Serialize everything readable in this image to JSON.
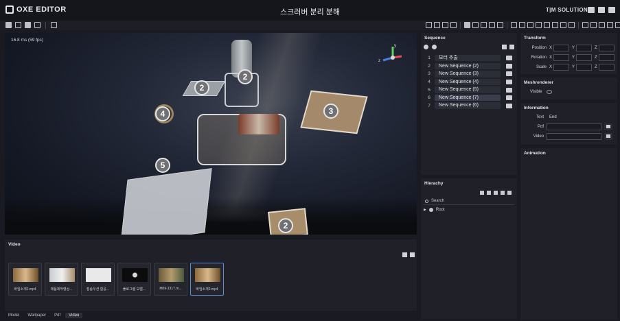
{
  "app": {
    "logo_text": "OXE EDITOR",
    "title": "스크러버 분리 분해",
    "brand": "T|M SOLUTION"
  },
  "viewport": {
    "fps": "16.8 ms (59 fps)",
    "gizmo": {
      "y_label": "y",
      "z_label": "z"
    },
    "badges": [
      "2",
      "2",
      "4",
      "3",
      "5",
      "2"
    ]
  },
  "video_panel": {
    "title": "Video",
    "thumbnails": [
      {
        "label": "바임소개2.mp4",
        "selected": false
      },
      {
        "label": "제품제작영상...",
        "selected": false
      },
      {
        "label": "접송우션 함공...",
        "selected": false
      },
      {
        "label": "풀로그램 모델...",
        "selected": false
      },
      {
        "label": "M09-1317.m...",
        "selected": false
      },
      {
        "label": "바임소개2.mp4",
        "selected": true
      }
    ]
  },
  "bottom_tabs": [
    "Model",
    "Wallpaper",
    "Pdf",
    "Video"
  ],
  "bottom_tab_active": "Video",
  "sequence": {
    "title": "Sequence",
    "items": [
      {
        "num": "1",
        "name": "모터 추출"
      },
      {
        "num": "2",
        "name": "New Sequence (2)"
      },
      {
        "num": "3",
        "name": "New Sequence (3)"
      },
      {
        "num": "4",
        "name": "New Sequence (4)"
      },
      {
        "num": "5",
        "name": "New Sequence (5)"
      },
      {
        "num": "6",
        "name": "New Sequence (7)"
      },
      {
        "num": "7",
        "name": "New Sequence (6)"
      }
    ],
    "selected_index": 5
  },
  "hierarchy": {
    "title": "Hierachy",
    "search_placeholder": "Search",
    "root_label": "Root"
  },
  "transform": {
    "title": "Transform",
    "rows": [
      "Position",
      "Rotation",
      "Scale"
    ],
    "axes": [
      "X",
      "Y",
      "Z"
    ]
  },
  "mesh": {
    "title": "Meshrenderer",
    "visible_label": "Visible"
  },
  "information": {
    "title": "Information",
    "text_label": "Text",
    "text_value": "End",
    "pdf_label": "Pdf",
    "video_label": "Video"
  },
  "animation": {
    "title": "Animation"
  },
  "colors": {
    "accent": "#5a8fd6",
    "panel": "#1f2028",
    "bg": "#1a1b22"
  }
}
